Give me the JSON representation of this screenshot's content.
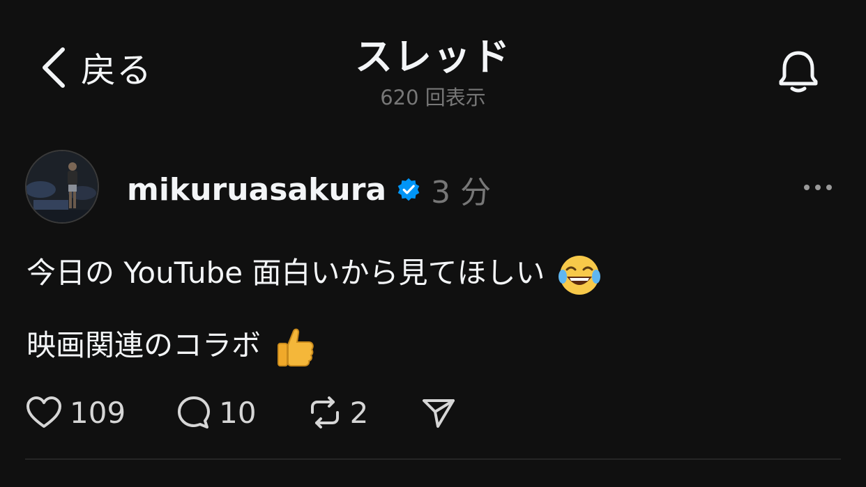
{
  "header": {
    "back_label": "戻る",
    "title": "スレッド",
    "view_count": "620 回表示"
  },
  "post": {
    "username": "mikuruasakura",
    "verified": true,
    "time_ago": "3 分",
    "lines": [
      "今日の YouTube 面白いから見てほしい",
      "映画関連のコラボ"
    ],
    "line_emojis": [
      "laughing-tears-emoji",
      "thumbs-up-emoji"
    ],
    "actions": {
      "likes": "109",
      "replies": "10",
      "reposts": "2"
    }
  },
  "colors": {
    "background": "#101010",
    "text": "#f3f5f7",
    "muted": "#777777",
    "verified": "#0095f6"
  },
  "icons": [
    "chevron-left-icon",
    "bell-icon",
    "verified-badge-icon",
    "more-icon",
    "heart-icon",
    "comment-icon",
    "repost-icon",
    "share-icon"
  ]
}
